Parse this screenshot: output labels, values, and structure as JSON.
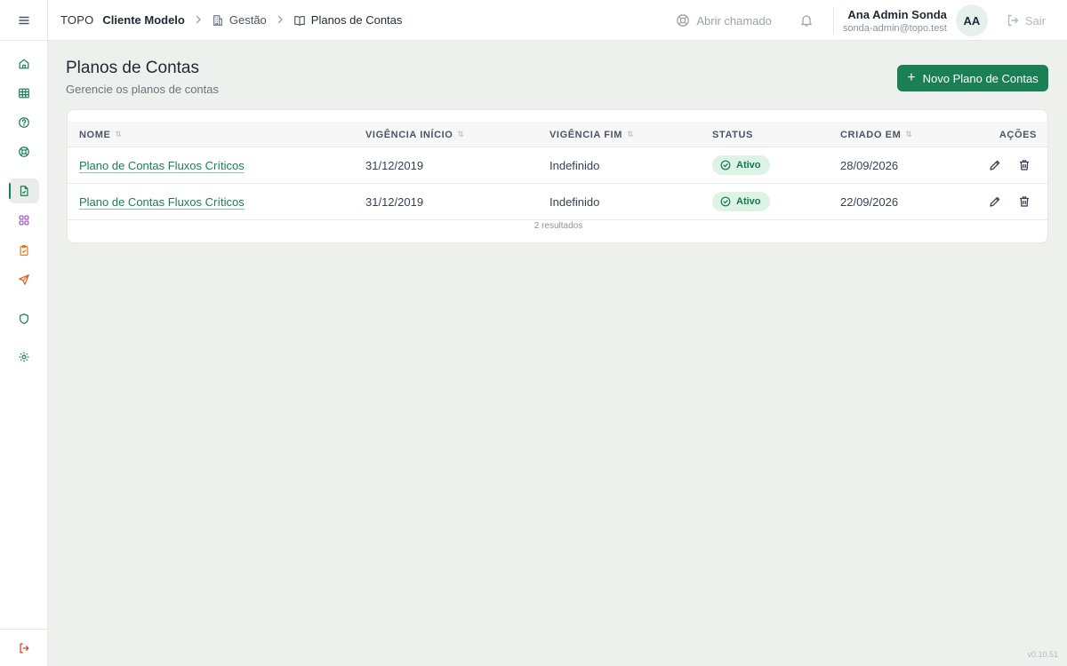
{
  "header": {
    "brand": "TOPO",
    "client": "Cliente Modelo",
    "breadcrumb": [
      {
        "label": "Gestão",
        "icon": "building-icon"
      },
      {
        "label": "Planos de Contas",
        "icon": "book-icon"
      }
    ],
    "support_label": "Abrir chamado",
    "user_name": "Ana Admin Sonda",
    "user_email": "sonda-admin@topo.test",
    "avatar_initials": "AA",
    "logout_label": "Sair"
  },
  "sidebar": {
    "items": [
      {
        "name": "home",
        "icon": "home-icon"
      },
      {
        "name": "table",
        "icon": "table-icon"
      },
      {
        "name": "help",
        "icon": "help-circle-icon"
      },
      {
        "name": "support",
        "icon": "lifebuoy-icon"
      },
      {
        "name": "documents",
        "icon": "document-icon",
        "active": true
      },
      {
        "name": "modules",
        "icon": "grid-icon"
      },
      {
        "name": "tasks",
        "icon": "clipboard-check-icon"
      },
      {
        "name": "send",
        "icon": "send-icon"
      },
      {
        "name": "security",
        "icon": "shield-icon"
      },
      {
        "name": "settings",
        "icon": "gear-icon"
      }
    ],
    "logout_icon": "logout-icon"
  },
  "page": {
    "title": "Planos de Contas",
    "subtitle": "Gerencie os planos de contas",
    "new_button_label": "Novo Plano de Contas"
  },
  "table": {
    "columns": {
      "nome": "NOME",
      "vigencia_inicio": "VIGÊNCIA INÍCIO",
      "vigencia_fim": "VIGÊNCIA FIM",
      "status": "STATUS",
      "criado_em": "CRIADO EM",
      "acoes": "AÇÕES"
    },
    "rows": [
      {
        "nome": "Plano de Contas Fluxos Críticos",
        "vigencia_inicio": "31/12/2019",
        "vigencia_fim": "Indefinido",
        "status": "Ativo",
        "criado_em": "28/09/2026"
      },
      {
        "nome": "Plano de Contas Fluxos Críticos",
        "vigencia_inicio": "31/12/2019",
        "vigencia_fim": "Indefinido",
        "status": "Ativo",
        "criado_em": "22/09/2026"
      }
    ],
    "results_label": "2 resultados"
  },
  "version": "v0.10.51",
  "colors": {
    "accent": "#1a7f55",
    "background": "#eef0ed",
    "badge_bg": "#dcf3e6"
  }
}
